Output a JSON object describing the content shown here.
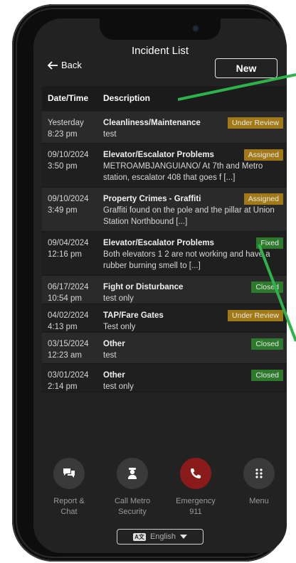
{
  "header": {
    "title": "Incident List",
    "back_label": "Back",
    "new_label": "New"
  },
  "table": {
    "col_date": "Date/Time",
    "col_desc": "Description",
    "rows": [
      {
        "date": "Yesterday",
        "time": "8:23 pm",
        "category": "Cleanliness/Maintenance",
        "text": "test",
        "status": "Under Review"
      },
      {
        "date": "09/10/2024",
        "time": "3:50 pm",
        "category": "Elevator/Escalator Problems",
        "text": "METROAMBJANGUIANO/ At 7th and Metro station, escalator 408 that goes f [...]",
        "status": "Assigned"
      },
      {
        "date": "09/10/2024",
        "time": "3:49 pm",
        "category": "Property Crimes - Graffiti",
        "text": "Graffiti found on the pole and the pillar at Union Station Northbound [...]",
        "status": "Assigned"
      },
      {
        "date": "09/04/2024",
        "time": "12:16 pm",
        "category": "Elevator/Escalator Problems",
        "text": "Both elevators 1 2 are not working and have a rubber burning smell to [...]",
        "status": "Fixed"
      },
      {
        "date": "06/17/2024",
        "time": "10:54 pm",
        "category": "Fight or Disturbance",
        "text": "test only",
        "status": "Closed"
      },
      {
        "date": "04/02/2024",
        "time": "4:13 pm",
        "category": "TAP/Fare Gates",
        "text": "Test only",
        "status": "Under Review"
      },
      {
        "date": "03/15/2024",
        "time": "12:23 am",
        "category": "Other",
        "text": "test",
        "status": "Closed"
      },
      {
        "date": "03/01/2024",
        "time": "2:14 pm",
        "category": "Other",
        "text": "test only",
        "status": "Closed"
      }
    ]
  },
  "bottom_nav": {
    "report_line1": "Report &",
    "report_line2": "Chat",
    "security_line1": "Call Metro",
    "security_line2": "Security",
    "emergency_line1": "Emergency",
    "emergency_line2": "911",
    "menu": "Menu"
  },
  "language": {
    "label": "English"
  },
  "colors": {
    "accent_green": "#2fb24a",
    "badge_yellow": "#a17a17",
    "badge_green": "#2d7a2d",
    "emergency_red": "#8b1a1a"
  }
}
